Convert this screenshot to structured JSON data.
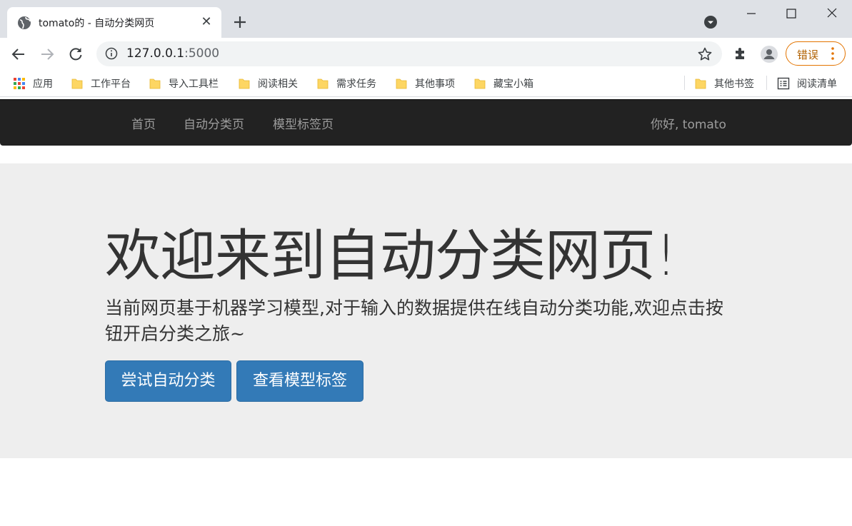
{
  "browser": {
    "tab_title": "tomato的 - 自动分类网页",
    "tab_close": "✕",
    "url_host": "127.0.0.1",
    "url_port": ":5000",
    "error_label": "错误",
    "bookmarks": [
      {
        "label": "应用",
        "icon": "apps-grid-icon"
      },
      {
        "label": "工作平台",
        "icon": "folder-icon"
      },
      {
        "label": "导入工具栏",
        "icon": "folder-icon"
      },
      {
        "label": "阅读相关",
        "icon": "folder-icon"
      },
      {
        "label": "需求任务",
        "icon": "folder-icon"
      },
      {
        "label": "其他事项",
        "icon": "folder-icon"
      },
      {
        "label": "藏宝小箱",
        "icon": "folder-icon"
      }
    ],
    "other_bookmarks": "其他书签",
    "reading_list": "阅读清单"
  },
  "navbar": {
    "links": [
      "首页",
      "自动分类页",
      "模型标签页"
    ],
    "greeting": "你好, tomato"
  },
  "jumbotron": {
    "title": "欢迎来到自动分类网页!",
    "description": "当前网页基于机器学习模型,对于输入的数据提供在线自动分类功能,欢迎点击按钮开启分类之旅~",
    "primary_button": "尝试自动分类",
    "secondary_button": "查看模型标签"
  },
  "colors": {
    "navbar_bg": "#222222",
    "jumbotron_bg": "#eeeeee",
    "button_primary": "#337ab7",
    "folder_yellow": "#fdd663"
  }
}
